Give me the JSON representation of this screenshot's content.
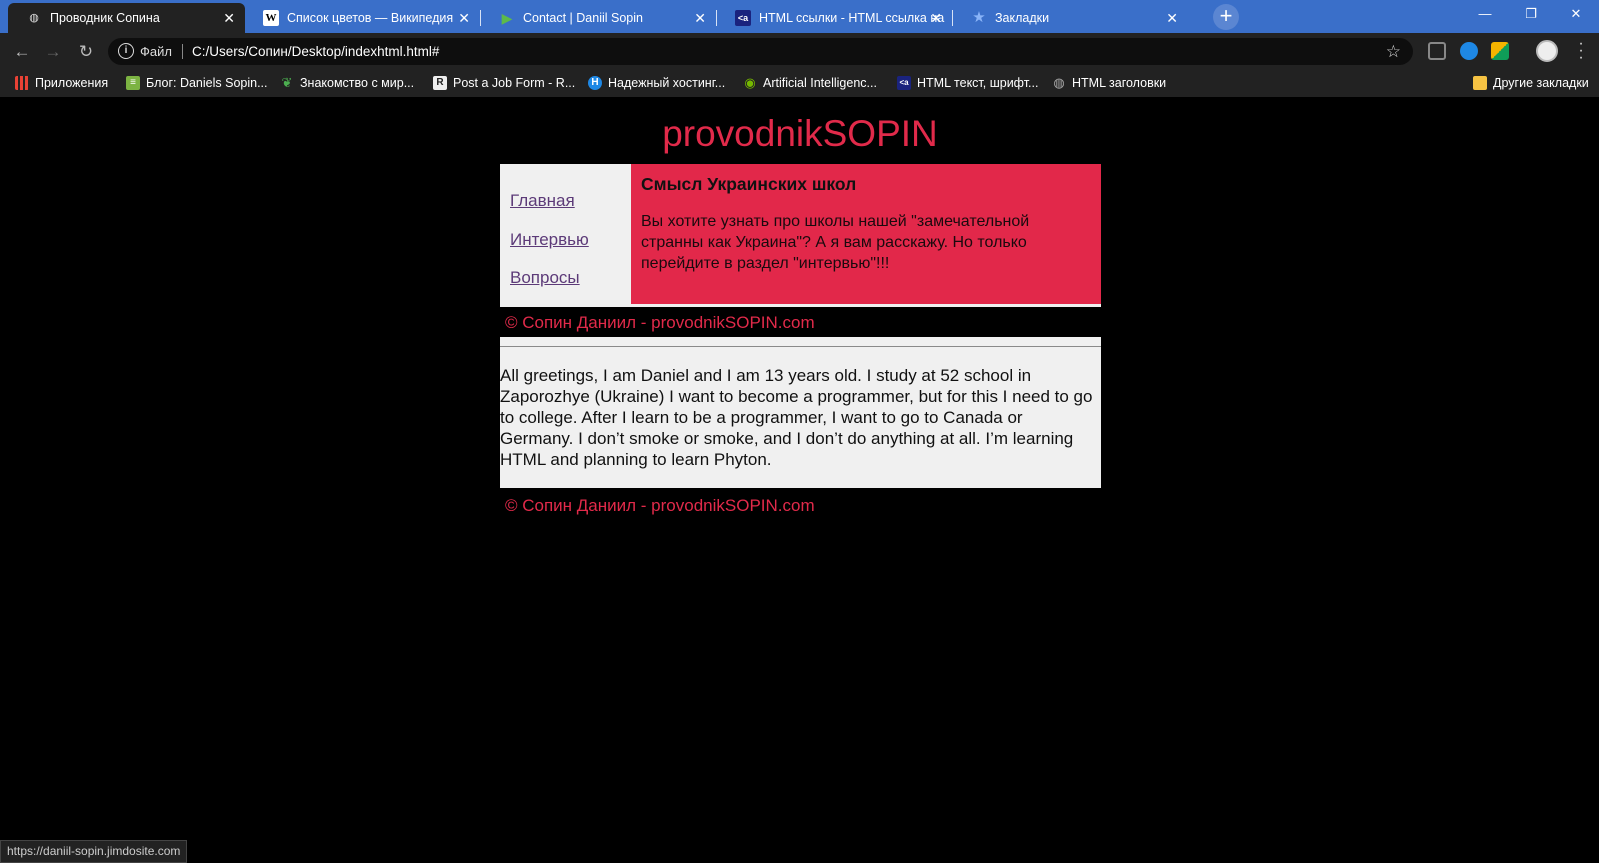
{
  "browser": {
    "tabs": [
      {
        "title": "Проводник Сопина",
        "icon": "globe-icon",
        "active": true
      },
      {
        "title": "Список цветов — Википедия",
        "icon": "wikipedia-icon",
        "active": false
      },
      {
        "title": "Contact | Daniil Sopin",
        "icon": "jimdo-icon",
        "active": false
      },
      {
        "title": "HTML ссылки - HTML ссылка на",
        "icon": "htmlbook-icon",
        "active": false
      },
      {
        "title": "Закладки",
        "icon": "star-icon",
        "active": false
      }
    ],
    "new_tab_symbol": "+",
    "window_controls": {
      "minimize": "—",
      "restore": "❐",
      "close": "✕"
    },
    "address": {
      "scheme_label": "Файл",
      "url": "C:/Users/Сопин/Desktop/indexhtml.html#"
    },
    "bookmarks": [
      {
        "label": "Приложения",
        "icon": "apps-grid-icon",
        "color": "#e94235"
      },
      {
        "label": "Блог: Daniels Sopin...",
        "icon": "blog-icon",
        "color": "#7cb342"
      },
      {
        "label": "Знакомство с мир...",
        "icon": "leaf-icon",
        "color": "#4caf50"
      },
      {
        "label": "Post a Job Form - R...",
        "icon": "r-icon",
        "color": "#333333"
      },
      {
        "label": "Надежный хостинг...",
        "icon": "hosting-icon",
        "color": "#1e88e5"
      },
      {
        "label": "Artificial Intelligenc...",
        "icon": "nvidia-icon",
        "color": "#76b900"
      },
      {
        "label": "HTML текст, шрифт...",
        "icon": "htmlbook-icon",
        "color": "#1a237e"
      },
      {
        "label": "HTML заголовки",
        "icon": "globe-icon",
        "color": "#777777"
      }
    ],
    "other_bookmarks": "Другие закладки",
    "status_url": "https://daniil-sopin.jimdosite.com"
  },
  "page": {
    "site_title": "provodnikSOPIN",
    "nav": [
      "Главная",
      "Интервью",
      "Вопросы"
    ],
    "article_title": "Смысл Украинских школ",
    "article_text": "Вы хотите узнать про школы нашей \"замечательной странны как Украина\"? А я вам расскажу. Но только перейдите в раздел \"интервью\"!!!",
    "footer": "© Сопин Даниил - provodnikSOPIN.com",
    "about_text": "All greetings, I am Daniel and I am 13 years old. I study at 52 school in Zaporozhye (Ukraine) I want to become a programmer, but for this I need to go to college. After I learn to be a programmer, I want to go to Canada or Germany. I don’t smoke or smoke, and I don’t do anything at all. I’m learning HTML and planning to learn Phyton."
  },
  "colors": {
    "accent_red": "#e12a4a",
    "article_bg": "#e2284a",
    "panel_bg": "#f0f0f0",
    "link": "#5c3a78",
    "tabstrip": "#3a6fc9"
  }
}
